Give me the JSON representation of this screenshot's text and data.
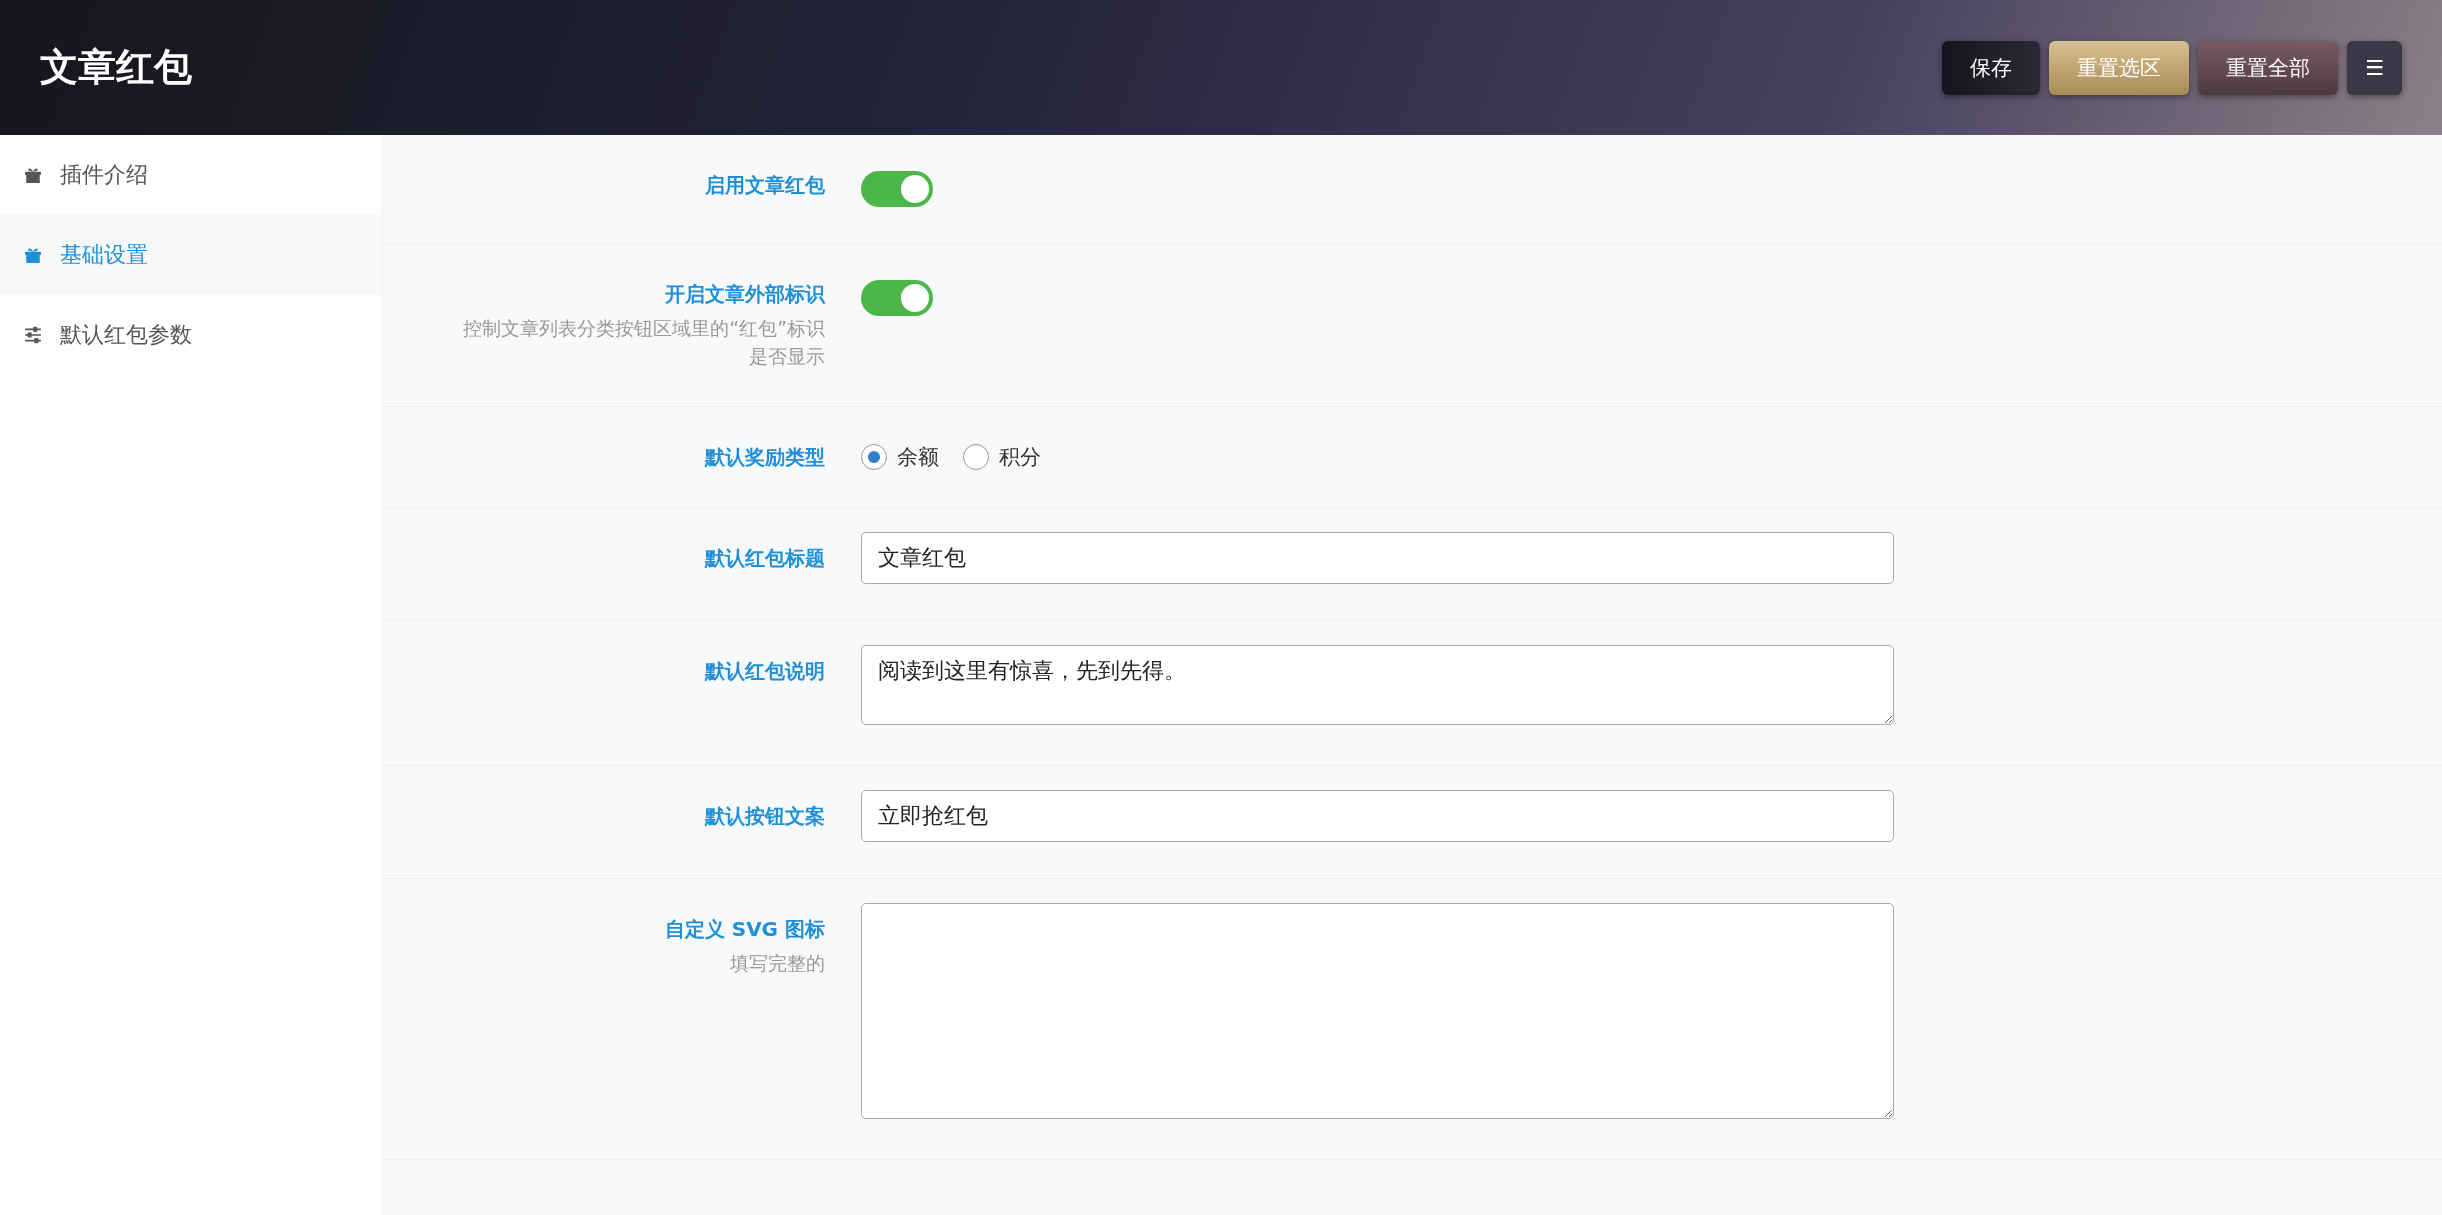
{
  "header": {
    "title": "文章红包",
    "buttons": [
      {
        "label": "保存",
        "kind": "save"
      },
      {
        "label": "重置选区",
        "kind": "reset-section"
      },
      {
        "label": "重置全部",
        "kind": "reset-all"
      },
      {
        "label": "☰",
        "kind": "menu"
      }
    ]
  },
  "sidebar": {
    "items": [
      {
        "label": "插件介绍",
        "selected": false
      },
      {
        "label": "基础设置",
        "selected": true
      },
      {
        "label": "默认红包参数",
        "selected": false
      }
    ]
  },
  "form": {
    "fields": [
      {
        "kind": "switch",
        "label": "启用文章红包",
        "on": true
      },
      {
        "kind": "switch",
        "label": "开启文章外部标识",
        "help": "控制文章列表分类按钮区域里的“红包”标识是否显示",
        "on": true
      },
      {
        "kind": "radio",
        "label": "默认奖励类型",
        "options": [
          {
            "label": "余额",
            "selected": true
          },
          {
            "label": "积分",
            "selected": false
          }
        ]
      },
      {
        "kind": "input",
        "label": "默认红包标题",
        "value": "文章红包"
      },
      {
        "kind": "textarea",
        "label": "默认红包说明",
        "value": "阅读到这里有惊喜，先到先得。"
      },
      {
        "kind": "input",
        "label": "默认按钮文案",
        "value": "立即抢红包"
      },
      {
        "kind": "textarea",
        "label": "自定义 SVG 图标",
        "help": "填写完整的"
      }
    ]
  }
}
